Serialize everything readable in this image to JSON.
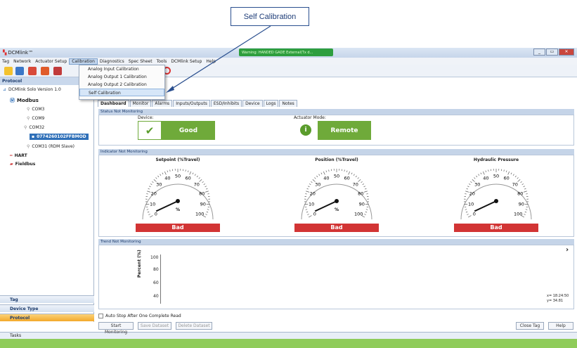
{
  "callout": {
    "label": "Self Calibration"
  },
  "window": {
    "title": "DCMlink™",
    "warning": "Warning: HANDED GADE External(Tx d..."
  },
  "menu": [
    "Tag",
    "Network",
    "Actuator Setup",
    "Calibration",
    "Diagnostics",
    "Spec Sheet",
    "Tools",
    "DCMlink Setup",
    "Help"
  ],
  "calibration_menu": [
    "Analog Input Calibration",
    "Analog Output 1 Calibration",
    "Analog Output 2 Calibration",
    "Self Calibration"
  ],
  "left": {
    "header": "Protocol",
    "root": "DCMlink Solo Version 1.0",
    "modbus": "Modbus",
    "com3": "COM3",
    "com9": "COM9",
    "com32": "COM32",
    "device": "0774260102FFBMOD",
    "com31": "COM31 (RDM Slave)",
    "hart": "HART",
    "fieldbus": "Fieldbus"
  },
  "nav": {
    "tag": "Tag",
    "device_type": "Device Type",
    "protocol": "Protocol",
    "tasks": "Tasks"
  },
  "tabs": [
    "Dashboard",
    "Monitor",
    "Alarms",
    "Inputs/Outputs",
    "ESD/Inhibits",
    "Device",
    "Logs",
    "Notes"
  ],
  "status": {
    "header": "Status Not Monitoring",
    "device_label": "Device:",
    "device_value": "Good",
    "actuator_label": "Actuator Mode:",
    "actuator_value": "Remote"
  },
  "indicator": {
    "header": "Indicator Not Monitoring",
    "gauges": [
      {
        "title": "Setpoint (%Travel)",
        "unit": "%",
        "status": "Bad"
      },
      {
        "title": "Position (%Travel)",
        "unit": "%",
        "status": "Bad"
      },
      {
        "title": "Hydraulic Pressure",
        "unit": "",
        "status": "Bad"
      }
    ],
    "ticks": [
      "0",
      "10",
      "20",
      "30",
      "40",
      "50",
      "60",
      "70",
      "80",
      "90",
      "100"
    ]
  },
  "trend": {
    "header": "Trend Not Monitoring",
    "ylabel": "Percent (%)",
    "yticks": [
      "100",
      "80",
      "60",
      "40"
    ],
    "readout_x": "x= 18:24:50",
    "readout_y": "y= 34.81"
  },
  "bottom": {
    "auto_stop": "Auto Stop After One Complete Read",
    "start": "Start Monitoring",
    "save": "Save Dataset",
    "delete": "Delete Dataset",
    "close": "Close Tag",
    "help": "Help"
  },
  "colors": {
    "good": "#6faa3a",
    "bad": "#d23434",
    "accent": "#2e6fb8"
  }
}
